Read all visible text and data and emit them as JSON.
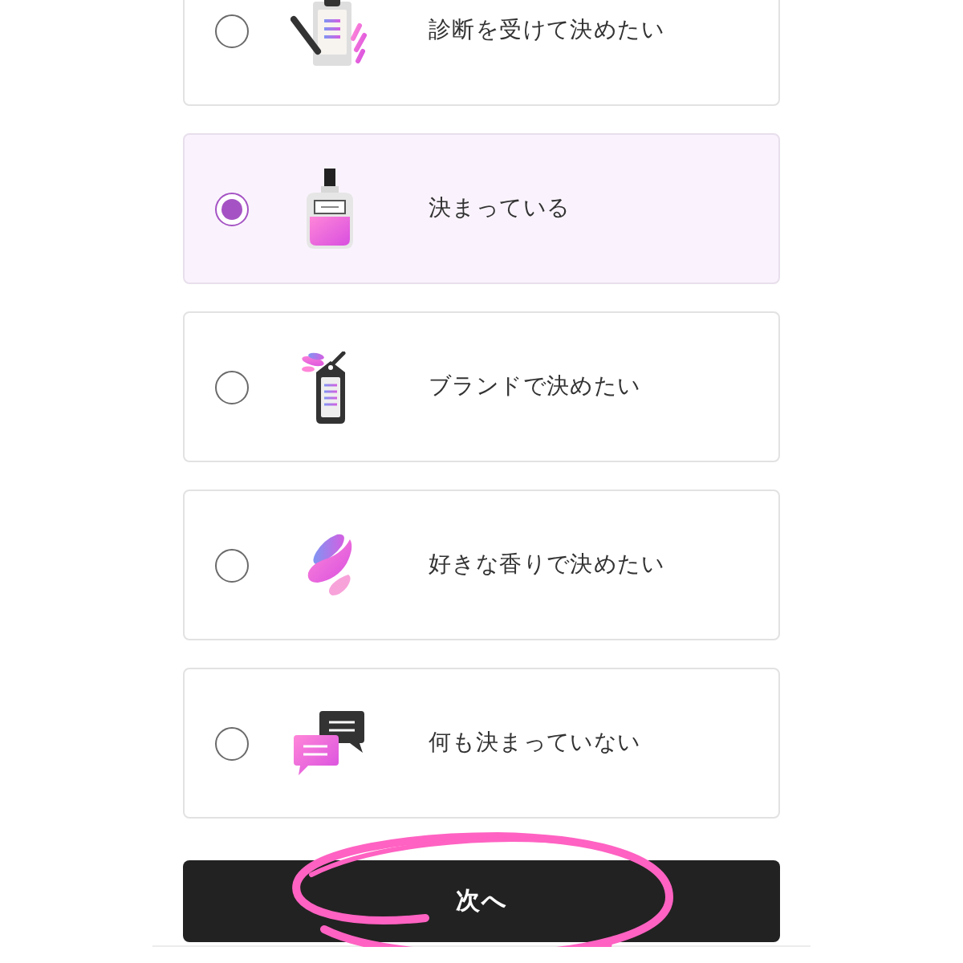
{
  "options": [
    {
      "label": "診断を受けて決めたい",
      "selected": false,
      "kind": "clipboard"
    },
    {
      "label": "決まっている",
      "selected": true,
      "kind": "bottle"
    },
    {
      "label": "ブランドで決めたい",
      "selected": false,
      "kind": "tag"
    },
    {
      "label": "好きな香りで決めたい",
      "selected": false,
      "kind": "strokes"
    },
    {
      "label": "何も決まっていない",
      "selected": false,
      "kind": "chat"
    }
  ],
  "next_button": {
    "label": "次へ"
  }
}
